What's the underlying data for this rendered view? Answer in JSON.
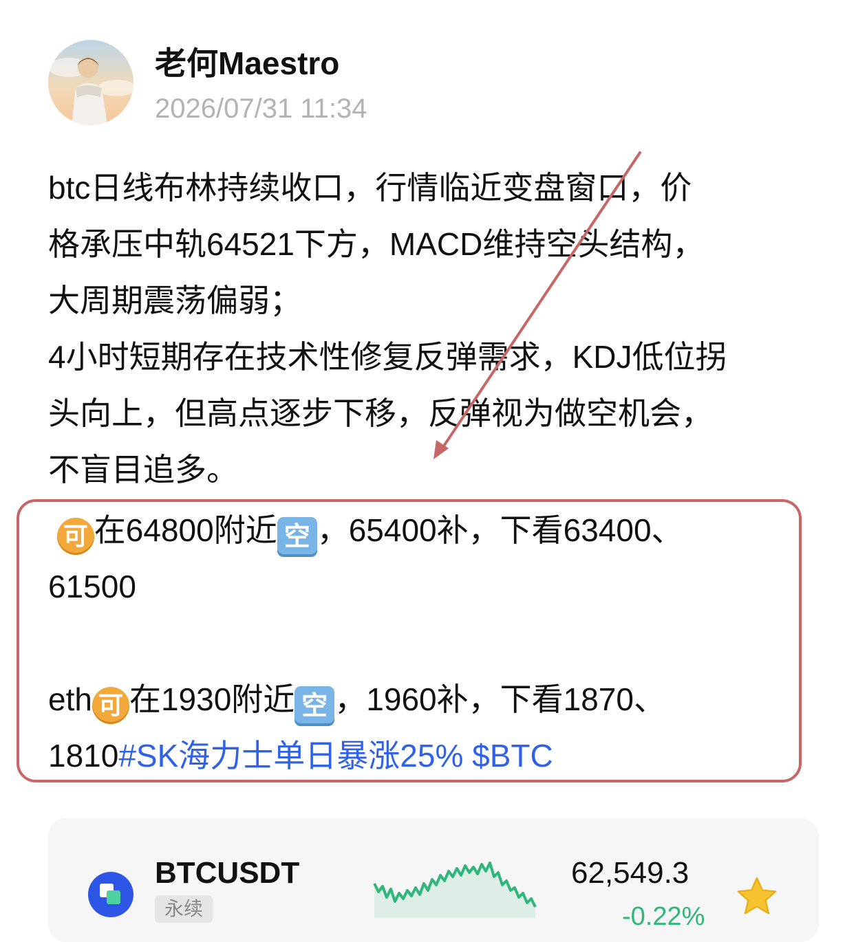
{
  "author": {
    "name": "老何Maestro",
    "timestamp": "2026/07/31 11:34"
  },
  "post": {
    "lines": [
      "btc日线布林持续收口，行情临近变盘窗口，价",
      "格承压中轨64521下方，MACD维持空头结构，",
      "大周期震荡偏弱；",
      "4小时短期存在技术性修复反弹需求，KDJ低位拐",
      "头向上，但高点逐步下移，反弹视为做空机会，",
      "不盲目追多。"
    ],
    "btc_plan": {
      "lead": "在64800附近",
      "rest": "，65400补，下看63400、",
      "targets": "61500"
    },
    "eth_plan": {
      "prefix": "eth",
      "lead": "在1930附近",
      "rest": "，1960补，下看1870、",
      "target": "1810",
      "hashtag": "#SK海力士单日暴涨25%",
      "cashtag": "$BTC"
    },
    "emoji": {
      "ke": "可",
      "kong": "空"
    }
  },
  "ticker_card": {
    "symbol": "BTCUSDT",
    "contract_label": "永续",
    "price": "62,549.3",
    "change": "-0.22%",
    "sparkline_color": "#2fb67c",
    "icon": "star-icon"
  },
  "colors": {
    "annotation": "#c76567",
    "link": "#2f62e6",
    "timestamp": "#b3b3b3"
  }
}
